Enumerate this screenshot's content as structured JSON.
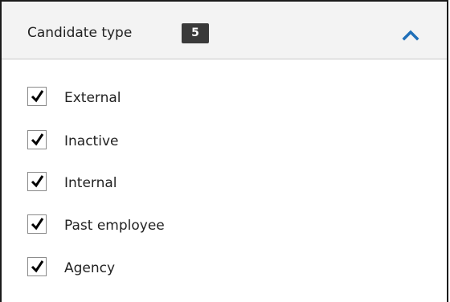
{
  "filter": {
    "title": "Candidate type",
    "selected_count": "5",
    "expanded": true,
    "accent_color": "#1f6fb8",
    "options": [
      {
        "label": "External",
        "checked": true
      },
      {
        "label": "Inactive",
        "checked": true
      },
      {
        "label": "Internal",
        "checked": true
      },
      {
        "label": "Past employee",
        "checked": true
      },
      {
        "label": "Agency",
        "checked": true
      }
    ]
  }
}
